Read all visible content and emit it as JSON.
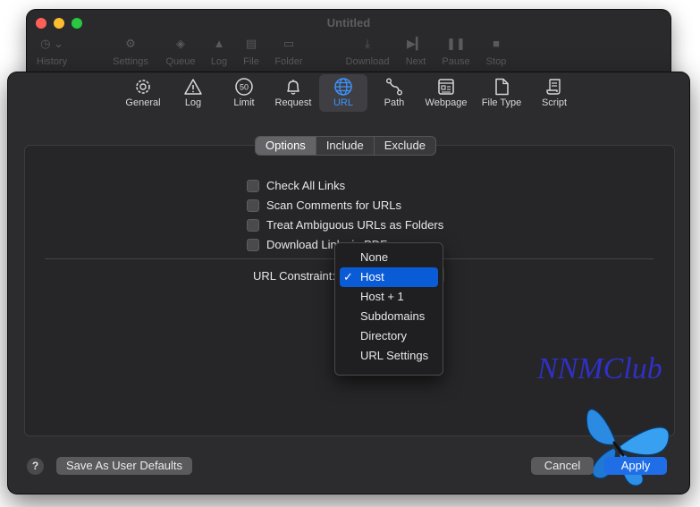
{
  "window": {
    "title": "Untitled"
  },
  "background_toolbar": [
    "History",
    "Settings",
    "Queue",
    "Log",
    "File",
    "Folder",
    "Download",
    "Next",
    "Pause",
    "Stop"
  ],
  "tabs": [
    {
      "label": "General",
      "icon": "gear-icon"
    },
    {
      "label": "Log",
      "icon": "warning-icon"
    },
    {
      "label": "Limit",
      "icon": "limit-icon",
      "badge": "50"
    },
    {
      "label": "Request",
      "icon": "bell-icon"
    },
    {
      "label": "URL",
      "icon": "globe-icon",
      "active": true
    },
    {
      "label": "Path",
      "icon": "path-icon"
    },
    {
      "label": "Webpage",
      "icon": "webpage-icon"
    },
    {
      "label": "File Type",
      "icon": "file-icon"
    },
    {
      "label": "Script",
      "icon": "script-icon"
    }
  ],
  "segments": [
    "Options",
    "Include",
    "Exclude"
  ],
  "selected_segment": "Options",
  "checkboxes": [
    "Check All Links",
    "Scan Comments for URLs",
    "Treat Ambiguous URLs as Folders",
    "Download Links in PDF"
  ],
  "constraint": {
    "label": "URL Constraint:"
  },
  "menu": {
    "items": [
      "None",
      "Host",
      "Host + 1",
      "Subdomains",
      "Directory",
      "URL Settings"
    ],
    "selected": "Host",
    "check": "✓"
  },
  "footer": {
    "help": "?",
    "defaults_label": "Save As User Defaults",
    "cancel_label": "Cancel",
    "apply_label": "Apply"
  },
  "watermark": "NNMClub",
  "colors": {
    "accent": "#3d93ff",
    "selection": "#0a5bd6",
    "close": "#ff5f57",
    "minimize": "#febc2e",
    "zoom": "#28c840"
  }
}
